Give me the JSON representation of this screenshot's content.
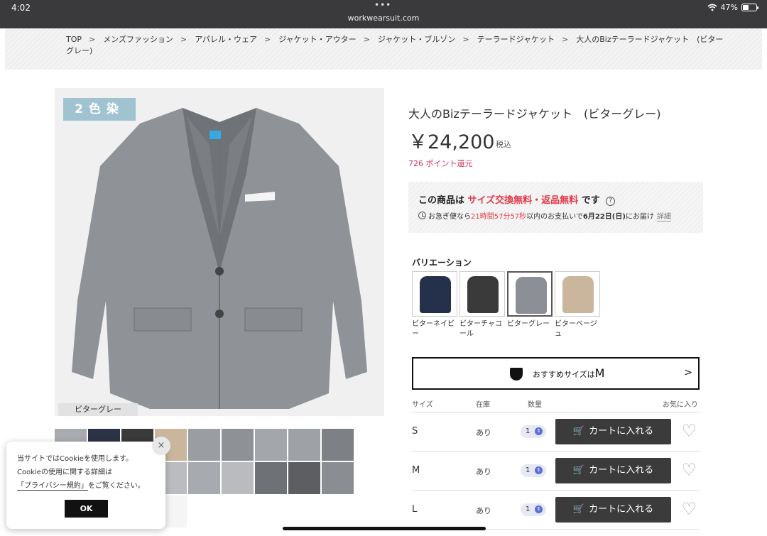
{
  "statusbar": {
    "time": "4:02",
    "url": "workwearsuit.com",
    "battery": "47%",
    "battery_level": 0.47
  },
  "breadcrumb": [
    "TOP",
    "メンズファッション",
    "アパレル・ウェア",
    "ジャケット・アウター",
    "ジャケット・ブルゾン",
    "テーラードジャケット",
    "大人のBizテーラードジャケット　(ビターグレー)"
  ],
  "gallery": {
    "badge": "2色染",
    "caption": "ビターグレー"
  },
  "product": {
    "title": "大人のBizテーラードジャケット　(ビターグレー)",
    "price": "￥24,200",
    "tax_label": "税込",
    "points": "726 ポイント還元"
  },
  "notice": {
    "prefix": "この商品は",
    "highlight": "サイズ交換無料・返品無料",
    "suffix": "です",
    "help_icon": "?",
    "delivery_a": "お急ぎ便なら",
    "delivery_time": "21時間57分57秒",
    "delivery_b": "以内のお支払いで",
    "delivery_date": "6月22日(日)",
    "delivery_c": "にお届け",
    "detail_link": "詳細"
  },
  "variations": {
    "heading": "バリエーション",
    "items": [
      {
        "label": "ビターネイビー",
        "color": "#25304a"
      },
      {
        "label": "ビターチャコール",
        "color": "#3a3a3a"
      },
      {
        "label": "ビターグレー",
        "color": "#8c8f95"
      },
      {
        "label": "ビターベージュ",
        "color": "#c9b69c"
      }
    ]
  },
  "size_reco": {
    "text": "おすすめサイズは",
    "size": "M",
    "chevron": ">"
  },
  "table": {
    "headers": {
      "size": "サイズ",
      "stock": "在庫",
      "qty": "数量",
      "fav": "お気に入り"
    },
    "rows": [
      {
        "size": "S",
        "stock": "あり",
        "qty": "1",
        "cart": "カートに入れる"
      },
      {
        "size": "M",
        "stock": "あり",
        "qty": "1",
        "cart": "カートに入れる"
      },
      {
        "size": "L",
        "stock": "あり",
        "qty": "1",
        "cart": "カートに入れる"
      }
    ]
  },
  "cookie": {
    "line1": "当サイトではCookieを使用します。",
    "line2": "Cookieの使用に関する詳細は",
    "line3_link": "「プライバシー規約」",
    "line3_rest": "をご覧ください。",
    "ok": "OK",
    "close": "×"
  },
  "colors": {
    "accent_red": "#e23a4a",
    "points_pink": "#d0335a",
    "cart_button": "#3b3b3b",
    "badge_blue": "#9fc3d1"
  }
}
